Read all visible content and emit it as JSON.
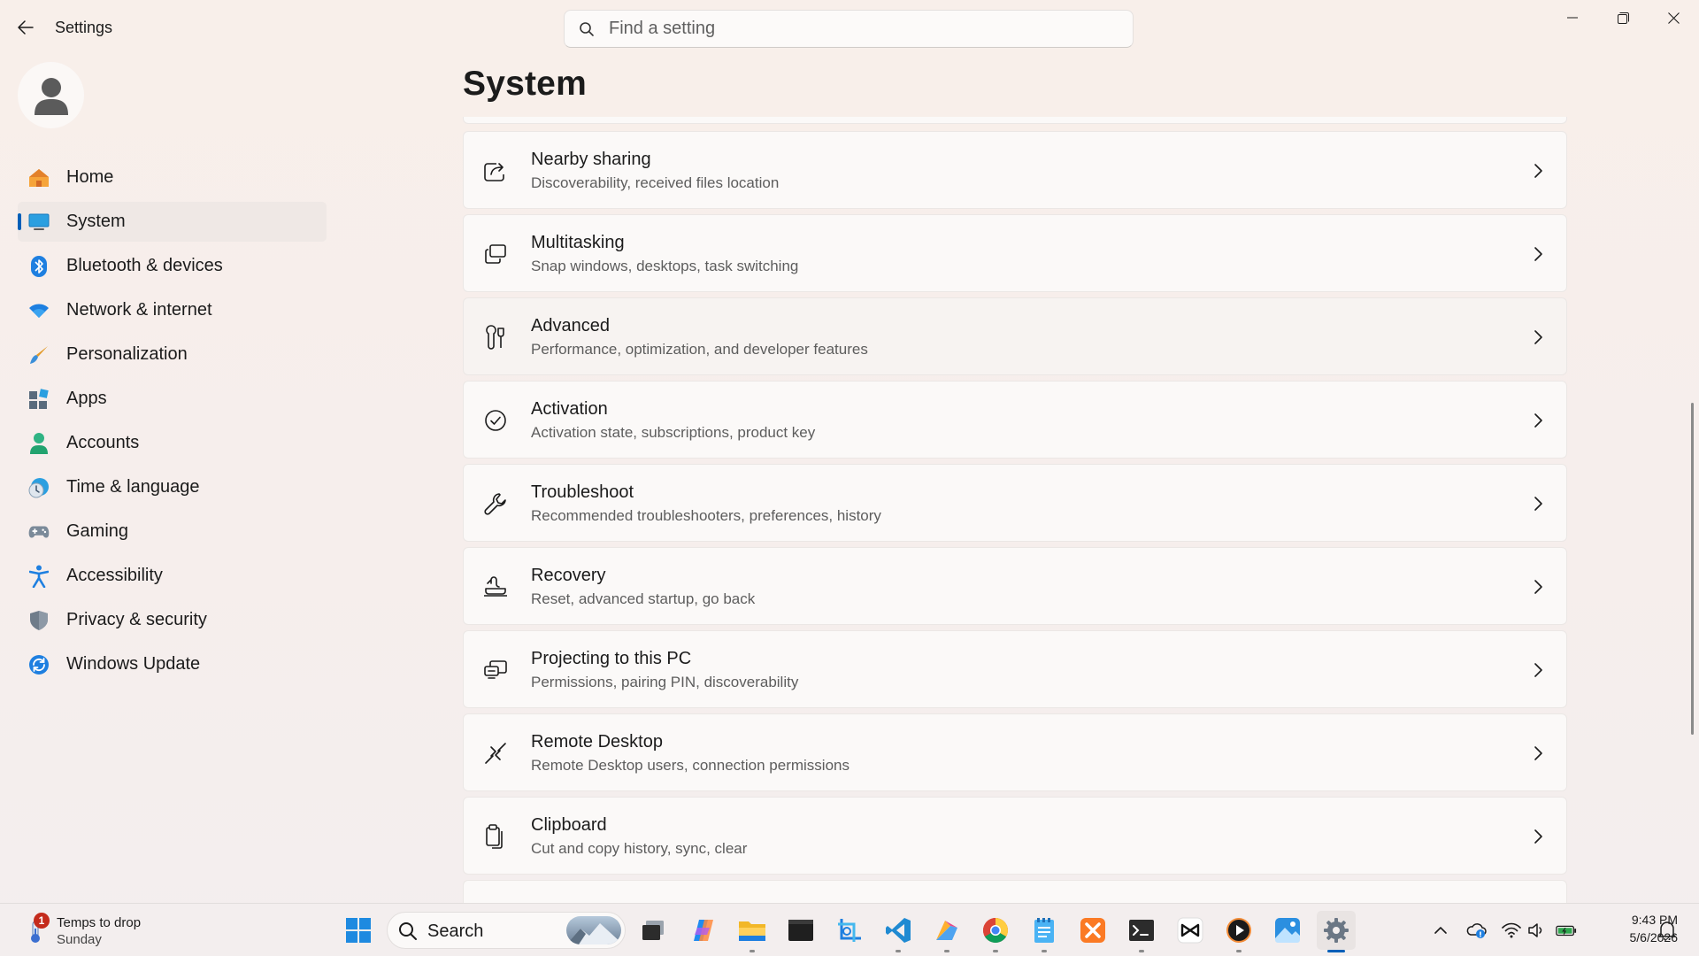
{
  "window": {
    "title": "Settings",
    "controls": [
      "minimize",
      "restore",
      "close"
    ]
  },
  "search": {
    "placeholder": "Find a setting"
  },
  "sidebar": {
    "items": [
      {
        "label": "Home",
        "icon": "home-icon",
        "selected": false
      },
      {
        "label": "System",
        "icon": "system-icon",
        "selected": true
      },
      {
        "label": "Bluetooth & devices",
        "icon": "bluetooth-icon",
        "selected": false
      },
      {
        "label": "Network & internet",
        "icon": "wifi-icon",
        "selected": false
      },
      {
        "label": "Personalization",
        "icon": "brush-icon",
        "selected": false
      },
      {
        "label": "Apps",
        "icon": "apps-icon",
        "selected": false
      },
      {
        "label": "Accounts",
        "icon": "person-icon",
        "selected": false
      },
      {
        "label": "Time & language",
        "icon": "clock-globe-icon",
        "selected": false
      },
      {
        "label": "Gaming",
        "icon": "gamepad-icon",
        "selected": false
      },
      {
        "label": "Accessibility",
        "icon": "accessibility-icon",
        "selected": false
      },
      {
        "label": "Privacy & security",
        "icon": "shield-icon",
        "selected": false
      },
      {
        "label": "Windows Update",
        "icon": "update-icon",
        "selected": false
      }
    ]
  },
  "main": {
    "title": "System",
    "cards": [
      {
        "title": "Nearby sharing",
        "subtitle": "Discoverability, received files location",
        "icon": "share-icon"
      },
      {
        "title": "Multitasking",
        "subtitle": "Snap windows, desktops, task switching",
        "icon": "multitasking-icon"
      },
      {
        "title": "Advanced",
        "subtitle": "Performance, optimization, and developer features",
        "icon": "advanced-tools-icon"
      },
      {
        "title": "Activation",
        "subtitle": "Activation state, subscriptions, product key",
        "icon": "check-circle-icon"
      },
      {
        "title": "Troubleshoot",
        "subtitle": "Recommended troubleshooters, preferences, history",
        "icon": "wrench-icon"
      },
      {
        "title": "Recovery",
        "subtitle": "Reset, advanced startup, go back",
        "icon": "recovery-icon"
      },
      {
        "title": "Projecting to this PC",
        "subtitle": "Permissions, pairing PIN, discoverability",
        "icon": "projecting-icon"
      },
      {
        "title": "Remote Desktop",
        "subtitle": "Remote Desktop users, connection permissions",
        "icon": "remote-desktop-icon"
      },
      {
        "title": "Clipboard",
        "subtitle": "Cut and copy history, sync, clear",
        "icon": "clipboard-icon"
      }
    ]
  },
  "taskbar": {
    "weather": {
      "line1": "Temps to drop",
      "line2": "Sunday",
      "badge": "1"
    },
    "search_label": "Search",
    "apps": [
      "start-icon",
      "task-view-icon",
      "copilot-icon",
      "file-explorer-icon",
      "terminal-dark-icon",
      "snipping-tool-icon",
      "vscode-icon",
      "pen-app-icon",
      "chrome-icon",
      "notepad-icon",
      "xampp-icon",
      "terminal-icon",
      "capcut-icon",
      "media-player-icon",
      "photos-icon",
      "settings-gear-icon"
    ],
    "tray": [
      "chevron-up-icon",
      "onedrive-icon",
      "wifi-tray-icon",
      "volume-icon",
      "battery-icon"
    ],
    "clock": {
      "time": "9:43 PM",
      "date": "5/6/2026"
    }
  },
  "colors": {
    "accent": "#005fb8",
    "background": "#f6eeec",
    "card": "#fbf9f8"
  }
}
